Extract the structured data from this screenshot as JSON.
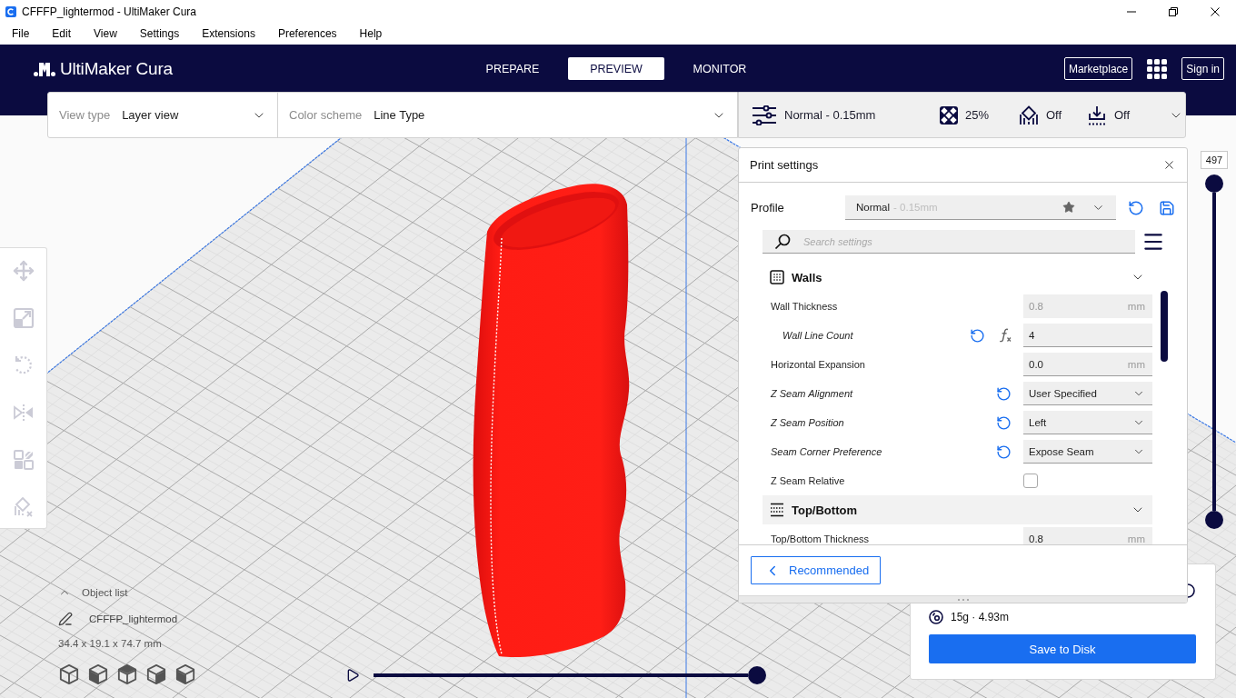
{
  "window": {
    "title": "CFFFP_lightermod - UltiMaker Cura"
  },
  "menu": [
    {
      "label": "File"
    },
    {
      "label": "Edit"
    },
    {
      "label": "View"
    },
    {
      "label": "Settings"
    },
    {
      "label": "Extensions"
    },
    {
      "label": "Preferences"
    },
    {
      "label": "Help"
    }
  ],
  "header": {
    "logo": "UltiMaker Cura",
    "stages": [
      {
        "label": "PREPARE",
        "selected": false
      },
      {
        "label": "PREVIEW",
        "selected": true
      },
      {
        "label": "MONITOR",
        "selected": false
      }
    ],
    "marketplace": "Marketplace",
    "sign_in": "Sign in"
  },
  "view_bar": {
    "view_type": {
      "label": "View type",
      "value": "Layer view"
    },
    "color_scheme": {
      "label": "Color scheme",
      "value": "Line Type"
    }
  },
  "print_setup": {
    "profile": "Normal - 0.15mm",
    "infill": "25%",
    "support": "Off",
    "adhesion": "Off"
  },
  "tools": [
    {
      "disabled": true
    },
    {
      "disabled": true
    },
    {
      "disabled": true
    },
    {
      "disabled": true
    },
    {
      "disabled": true
    },
    {
      "disabled": true
    }
  ],
  "print_settings": {
    "title": "Print settings",
    "profile": {
      "label": "Profile",
      "name": "Normal",
      "detail": "- 0.15mm"
    },
    "search": {
      "placeholder": "Search settings"
    },
    "categories": [
      {
        "label": "Walls",
        "expanded": true,
        "highlighted": false,
        "settings": [
          {
            "label": "Wall Thickness",
            "kind": "number",
            "value": "0.8",
            "unit": "mm",
            "modified": false,
            "disabled": true,
            "formula": false,
            "children": [
              {
                "label": "Wall Line Count",
                "kind": "number",
                "value": "4",
                "modified": true,
                "disabled": false,
                "formula": true
              }
            ]
          },
          {
            "label": "Horizontal Expansion",
            "kind": "number",
            "value": "0.0",
            "unit": "mm",
            "modified": false,
            "disabled": false,
            "formula": false
          },
          {
            "label": "Z Seam Alignment",
            "kind": "select",
            "value": "User Specified",
            "modified": true,
            "disabled": false,
            "formula": false
          },
          {
            "label": "Z Seam Position",
            "kind": "select",
            "value": "Left",
            "modified": true,
            "disabled": false,
            "formula": false
          },
          {
            "label": "Seam Corner Preference",
            "kind": "select",
            "value": "Expose Seam",
            "modified": true,
            "disabled": false,
            "formula": false
          },
          {
            "label": "Z Seam Relative",
            "kind": "checkbox",
            "checked": false,
            "modified": false,
            "disabled": false,
            "formula": false
          }
        ]
      },
      {
        "label": "Top/Bottom",
        "expanded": true,
        "highlighted": true,
        "settings": [
          {
            "label": "Top/Bottom Thickness",
            "kind": "number",
            "value": "0.8",
            "unit": "mm",
            "modified": false,
            "disabled": false,
            "formula": false
          }
        ]
      }
    ],
    "mode_button": "Recommended"
  },
  "layer_slider": {
    "label": "497",
    "level": 1
  },
  "object_list": {
    "title": "Object list",
    "expanded": false,
    "object": "CFFFP_lightermod",
    "dimensions": "34.4 x 19.1 x 74.7 mm"
  },
  "timeline": {
    "level": 1
  },
  "action_panel": {
    "material": "15g · 4.93m",
    "button": "Save to Disk"
  }
}
